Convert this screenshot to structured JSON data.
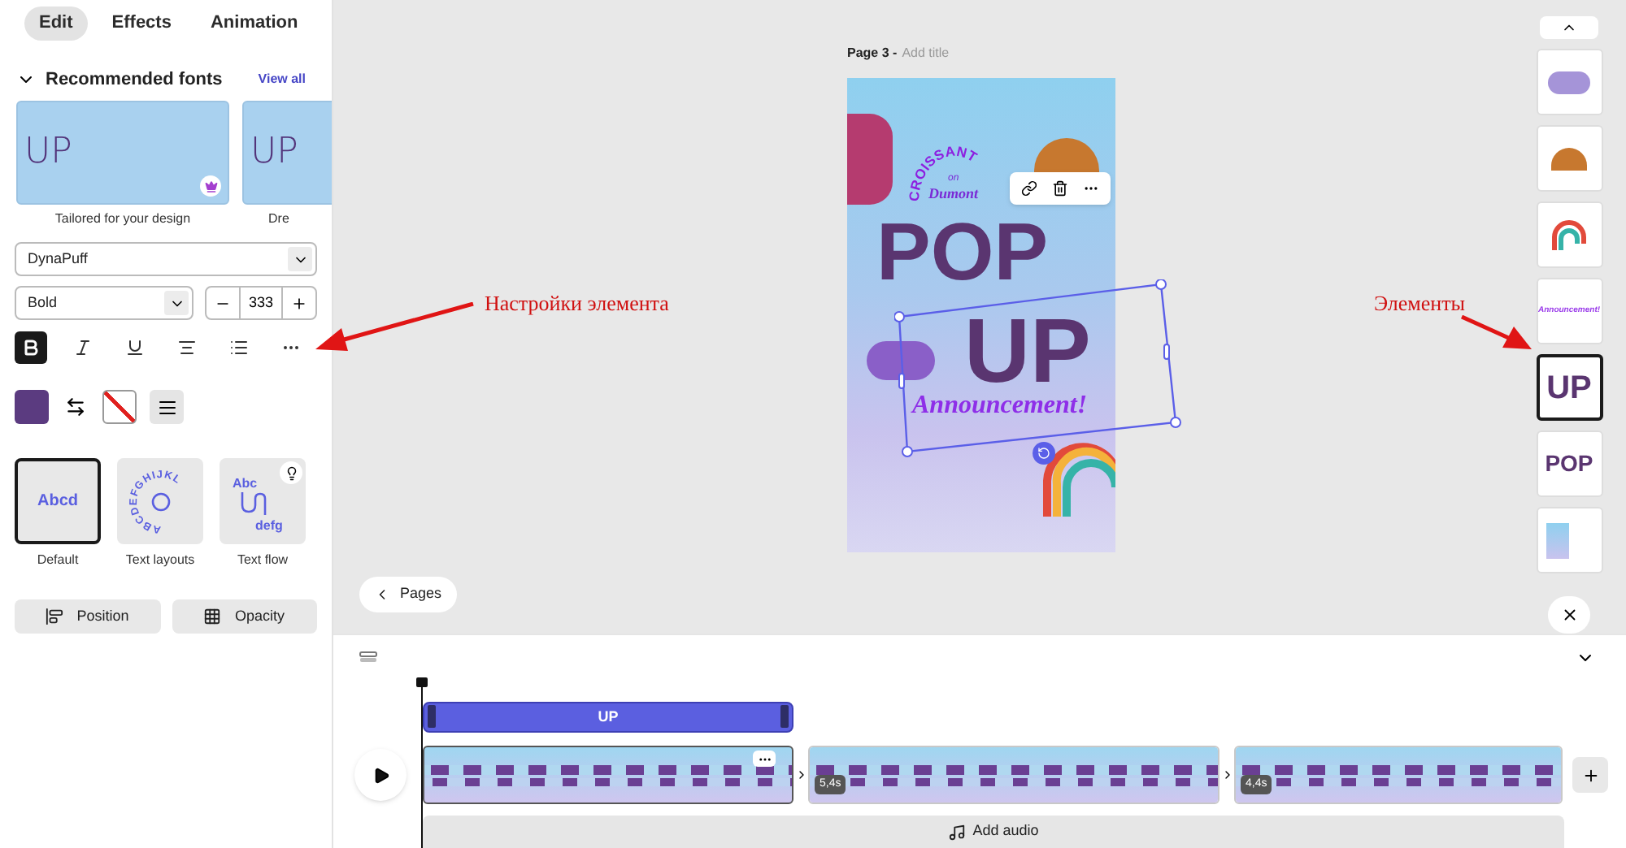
{
  "panel": {
    "tabs": [
      {
        "label": "Edit",
        "selected": true
      },
      {
        "label": "Effects",
        "selected": false
      },
      {
        "label": "Animation",
        "selected": false
      }
    ],
    "fonts_section": {
      "title": "Recommended fonts",
      "expanded": true,
      "link": "View all",
      "cards": [
        {
          "sample": "UP",
          "caption": "Tailored for your design",
          "premium": true
        },
        {
          "sample": "UP",
          "caption": "Dre",
          "premium": false
        }
      ]
    },
    "font_family": "DynaPuff",
    "font_weight": "Bold",
    "font_size": "333",
    "format": [
      {
        "kind": "bold",
        "on": true
      },
      {
        "kind": "italic",
        "on": false
      },
      {
        "kind": "underline",
        "on": false
      },
      {
        "kind": "align",
        "on": false
      },
      {
        "kind": "list",
        "on": false
      },
      {
        "kind": "more",
        "on": false
      }
    ],
    "layouts": [
      {
        "kind": "default",
        "label": "Default",
        "sample": "Abcd",
        "selected": true
      },
      {
        "kind": "circle",
        "label": "Text layouts",
        "sample": "ABCDEFGHIJKL",
        "selected": false
      },
      {
        "kind": "flow",
        "label": "Text flow",
        "sample": "Abc",
        "sample_2": "defg",
        "selected": false
      }
    ],
    "buttons": [
      {
        "kind": "position",
        "label": "Position"
      },
      {
        "kind": "opacity",
        "label": "Opacity"
      }
    ]
  },
  "canvas": {
    "page_label": "Page 3 -",
    "title_placeholder": "Add title",
    "design": {
      "arc_title": "CROISSANT",
      "small": "on",
      "script": "Dumont",
      "headline": "POP",
      "headline_2": "UP",
      "tagline": "Announcement!"
    },
    "pages_button": "Pages"
  },
  "elements": [
    {
      "kind": "cloud",
      "selected": false
    },
    {
      "kind": "croissant",
      "selected": false
    },
    {
      "kind": "rainbow",
      "selected": false
    },
    {
      "kind": "text",
      "text": "Announcement!",
      "selected": false
    },
    {
      "kind": "text",
      "text": "UP",
      "selected": true
    },
    {
      "kind": "text",
      "text": "POP",
      "selected": false
    },
    {
      "kind": "image",
      "selected": false
    }
  ],
  "annotations": [
    {
      "text": "Настройки элемента"
    },
    {
      "text": "Элементы"
    }
  ],
  "timeline": {
    "track_label": "UP",
    "clips": [
      {
        "selected": true
      },
      {
        "selected": false,
        "duration": "5,4s"
      },
      {
        "selected": false,
        "duration": "4,4s"
      }
    ],
    "add_audio": "Add audio"
  }
}
